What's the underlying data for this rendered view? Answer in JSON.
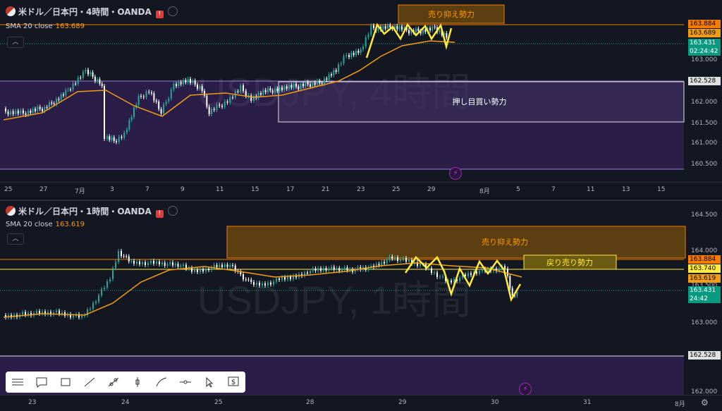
{
  "top_chart": {
    "symbol": "米ドル／日本円・4時間・OANDA",
    "indicator_label": "SMA 20 close",
    "indicator_value": "163.689",
    "watermark": "USDJPY, 4時間",
    "price_ticks": [
      "163.000",
      "162.000",
      "161.500",
      "161.000",
      "160.500"
    ],
    "date_ticks": [
      "25",
      "27",
      "7月",
      "3",
      "7",
      "9",
      "11",
      "15",
      "17",
      "21",
      "23",
      "25",
      "29",
      "8月",
      "5",
      "7",
      "11",
      "13",
      "15"
    ],
    "tags": {
      "high": "163.884",
      "sma": "163.689",
      "last": "163.431",
      "countdown": "02:24:42",
      "support": "162.528"
    },
    "annotations": {
      "sell": "売り抑え勢力",
      "buy": "押し目買い勢力"
    }
  },
  "bottom_chart": {
    "symbol": "米ドル／日本円・1時間・OANDA",
    "indicator_label": "SMA 20 close",
    "indicator_value": "163.619",
    "watermark": "USDJPY, 1時間",
    "price_ticks": [
      "164.500",
      "164.000",
      "163.500",
      "163.000",
      "162.000"
    ],
    "date_ticks": [
      "23",
      "24",
      "25",
      "28",
      "29",
      "30",
      "31",
      "8月"
    ],
    "tags": {
      "high": "163.884",
      "resist": "163.740",
      "sma": "163.619",
      "last": "163.431",
      "countdown": "24:42",
      "support": "162.528"
    },
    "annotations": {
      "sell": "売り抑え勢力",
      "rebound": "戻り売り勢力"
    }
  },
  "toolbar": {
    "tools": [
      "drag-handle-icon",
      "comment-icon",
      "rectangle-icon",
      "trend-line-icon",
      "ray-icon",
      "price-line-icon",
      "brush-icon",
      "horizontal-line-icon",
      "cursor-icon",
      "price-label-icon"
    ]
  },
  "colors": {
    "bg": "#131722",
    "up": "#26a69a",
    "down": "#ffffff",
    "sma": "#f39c12",
    "zone": "#2e1f4d",
    "sell": "#5c3f11",
    "yellow": "#ffeb3b",
    "last": "#089981",
    "orange": "#f57c00"
  }
}
